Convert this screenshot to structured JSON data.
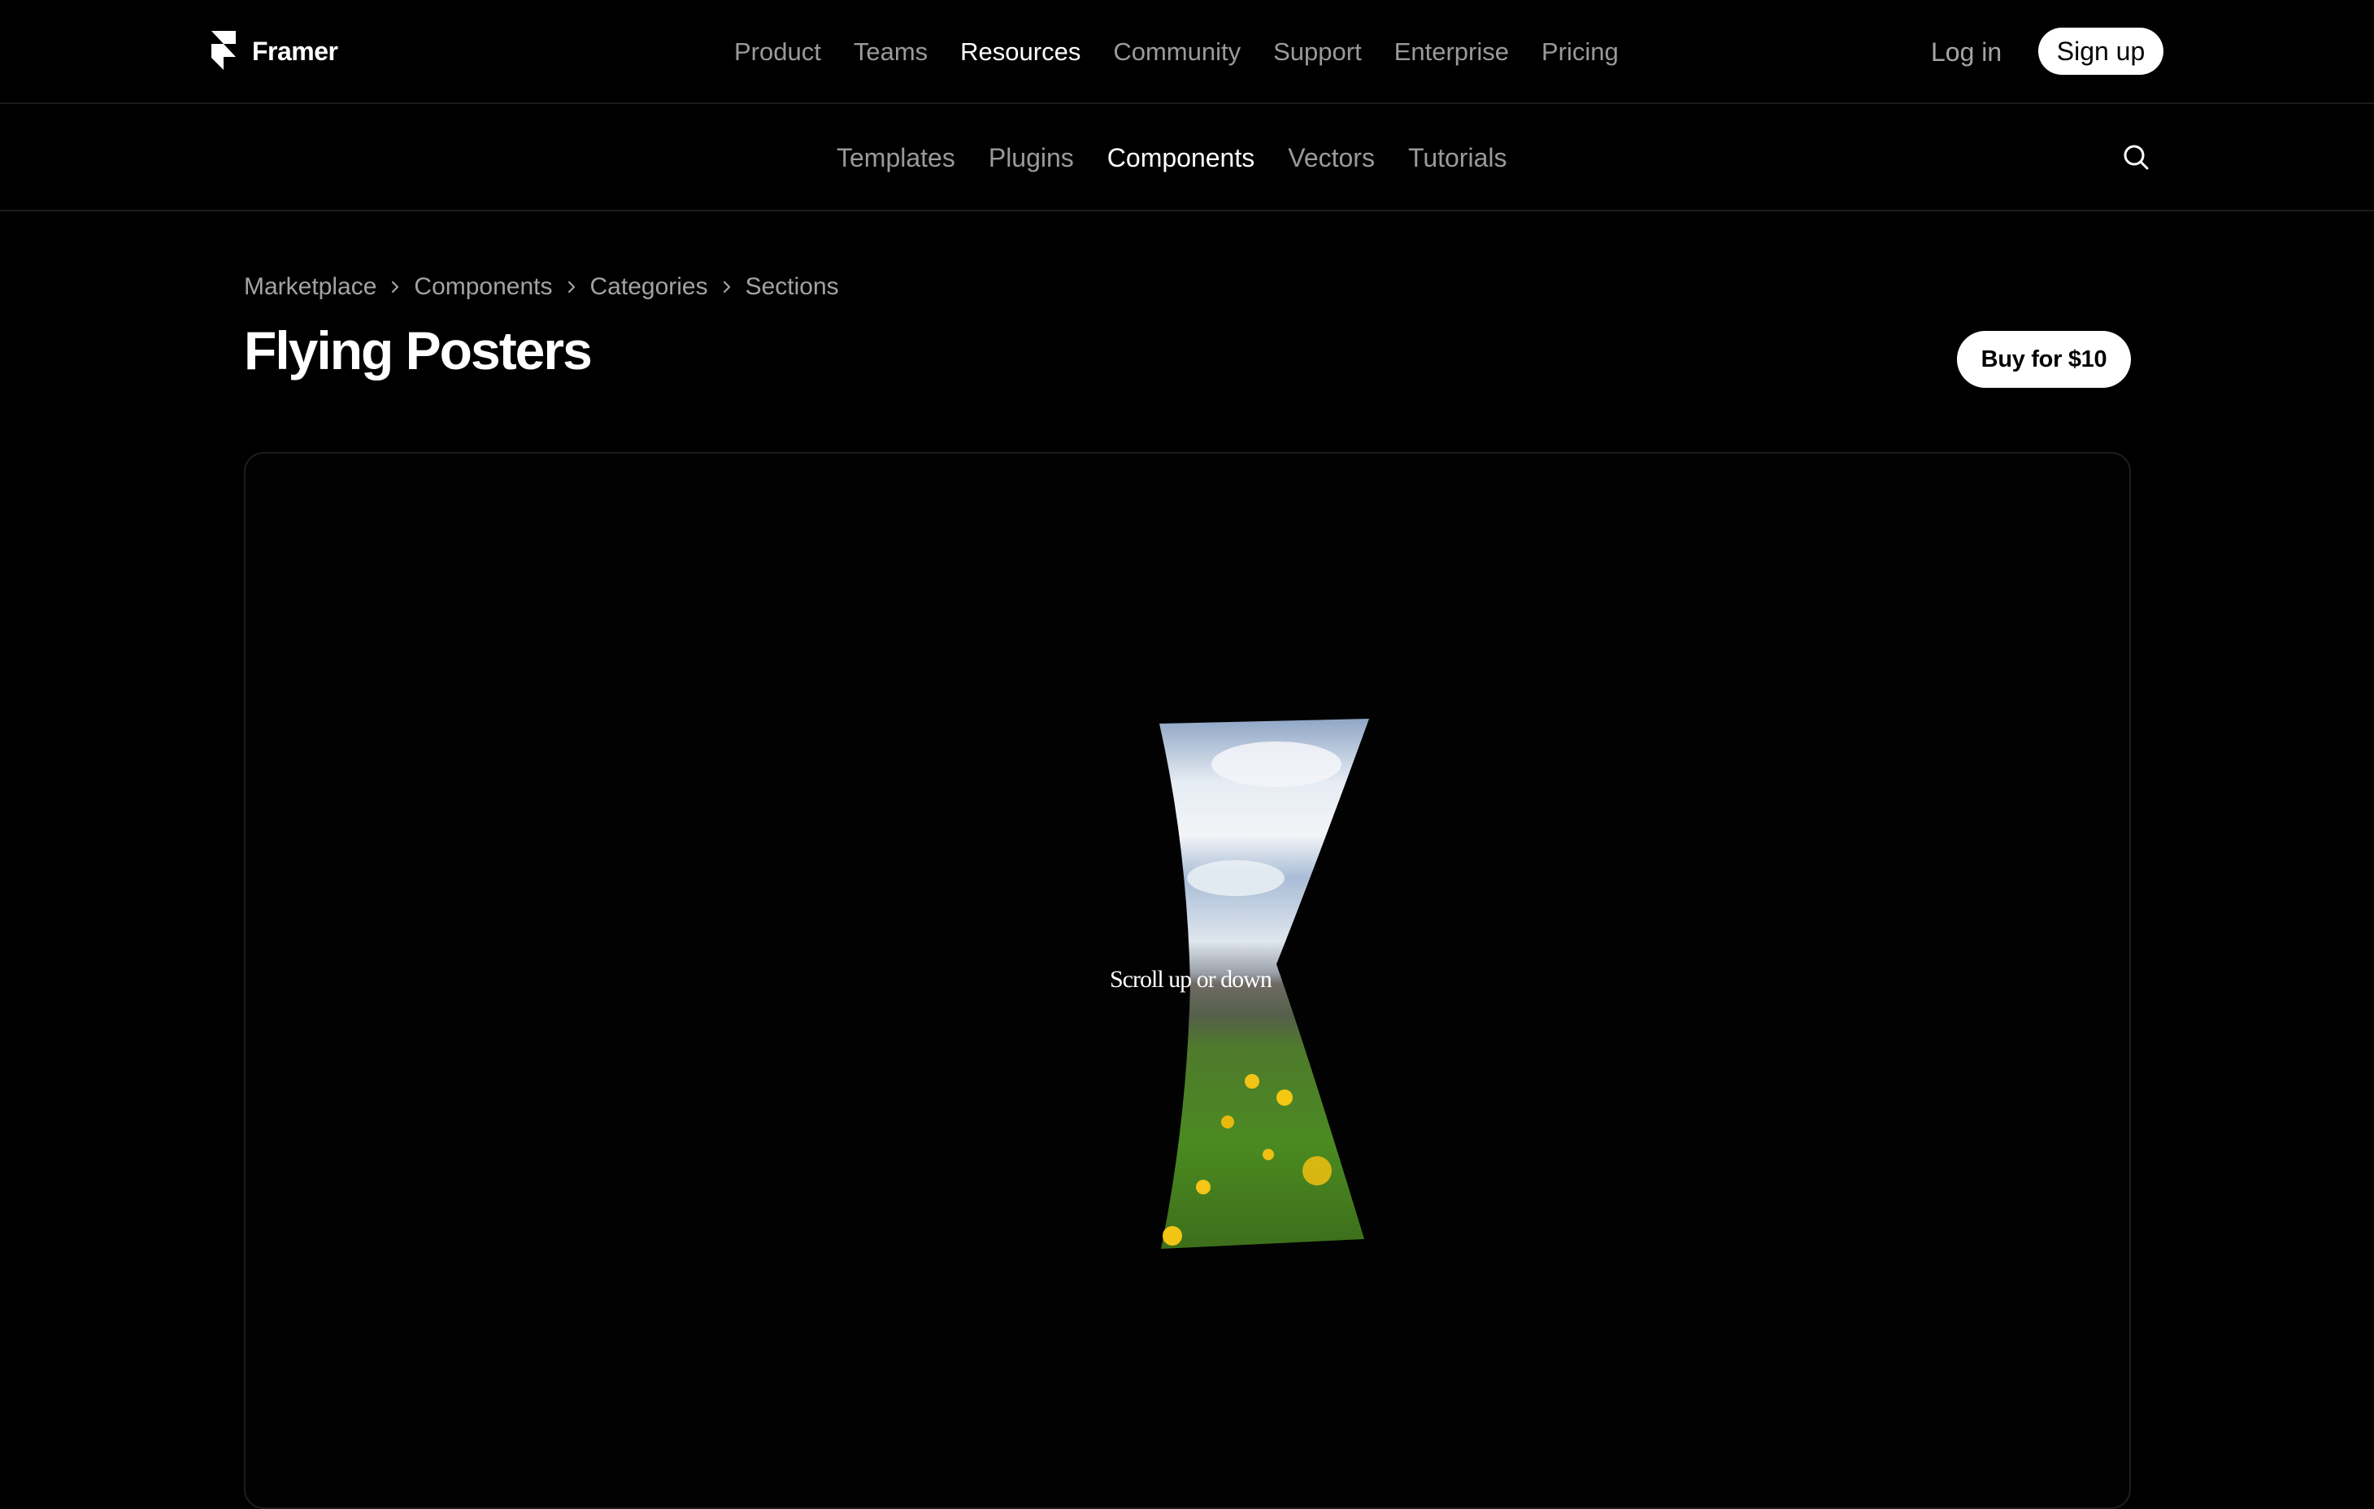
{
  "brand": {
    "name": "Framer",
    "logo_icon": "framer-logo-icon"
  },
  "top_nav": {
    "links": [
      {
        "label": "Product",
        "active": false
      },
      {
        "label": "Teams",
        "active": false
      },
      {
        "label": "Resources",
        "active": true
      },
      {
        "label": "Community",
        "active": false
      },
      {
        "label": "Support",
        "active": false
      },
      {
        "label": "Enterprise",
        "active": false
      },
      {
        "label": "Pricing",
        "active": false
      }
    ],
    "login_label": "Log in",
    "signup_label": "Sign up"
  },
  "sub_nav": {
    "links": [
      {
        "label": "Templates",
        "active": false
      },
      {
        "label": "Plugins",
        "active": false
      },
      {
        "label": "Components",
        "active": true
      },
      {
        "label": "Vectors",
        "active": false
      },
      {
        "label": "Tutorials",
        "active": false
      }
    ],
    "search_icon": "search-icon"
  },
  "breadcrumb": [
    "Marketplace",
    "Components",
    "Categories",
    "Sections"
  ],
  "page": {
    "title": "Flying Posters",
    "buy_label": "Buy for $10"
  },
  "preview": {
    "hint": "Scroll up or down"
  },
  "colors": {
    "background": "#000000",
    "muted_text": "#9a9a9a",
    "button_bg": "#ffffff"
  }
}
